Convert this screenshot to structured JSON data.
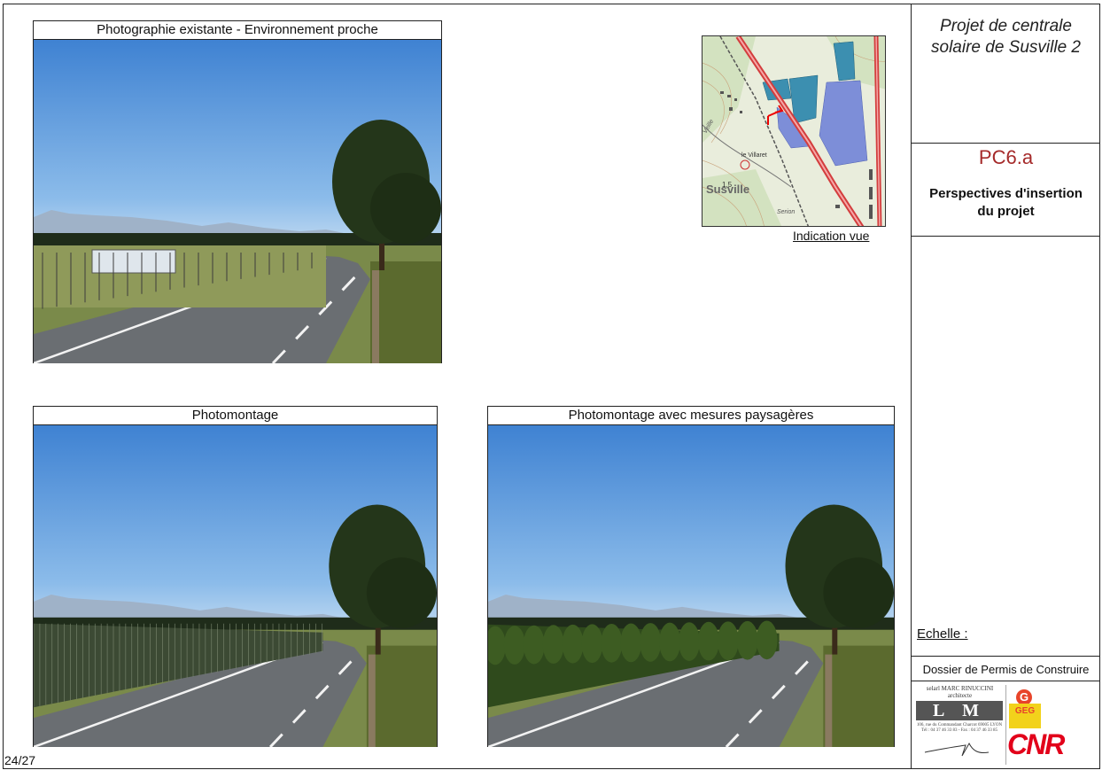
{
  "project": {
    "title_line1": "Projet de centrale",
    "title_line2": "solaire de Susville 2"
  },
  "sheet": {
    "code": "PC6.a",
    "desc_line1": "Perspectives d'insertion",
    "desc_line2": "du projet"
  },
  "scale_label": "Echelle :",
  "dossier_label": "Dossier de Permis de Construire",
  "architect": {
    "line1": "selarl MARC RINUCCINI",
    "line2": "architecte",
    "logo": "L M",
    "address": "106, rue du Commandant Charcot 69005 LYON",
    "contact": "Tél : 04 37 46 33 83 - Fax : 04 37 46 33 85"
  },
  "logos": {
    "geg": "GEG",
    "cnr": "CNR"
  },
  "photos": {
    "existing_title": "Photographie existante  -  Environnement proche",
    "montage_title": "Photomontage",
    "montage_landscape_title": "Photomontage avec mesures paysagères"
  },
  "map": {
    "caption": "Indication vue",
    "place": "Susville",
    "hamlet": "le Villaret",
    "altitude": "1,5",
    "label_serion": "Serion",
    "label_veille": "Veille"
  },
  "page": "24/27",
  "colors": {
    "accent": "#a52a2a",
    "cnr_red": "#e2001a",
    "geg_yellow": "#f2d21b",
    "sky": "#4d8fd6"
  }
}
